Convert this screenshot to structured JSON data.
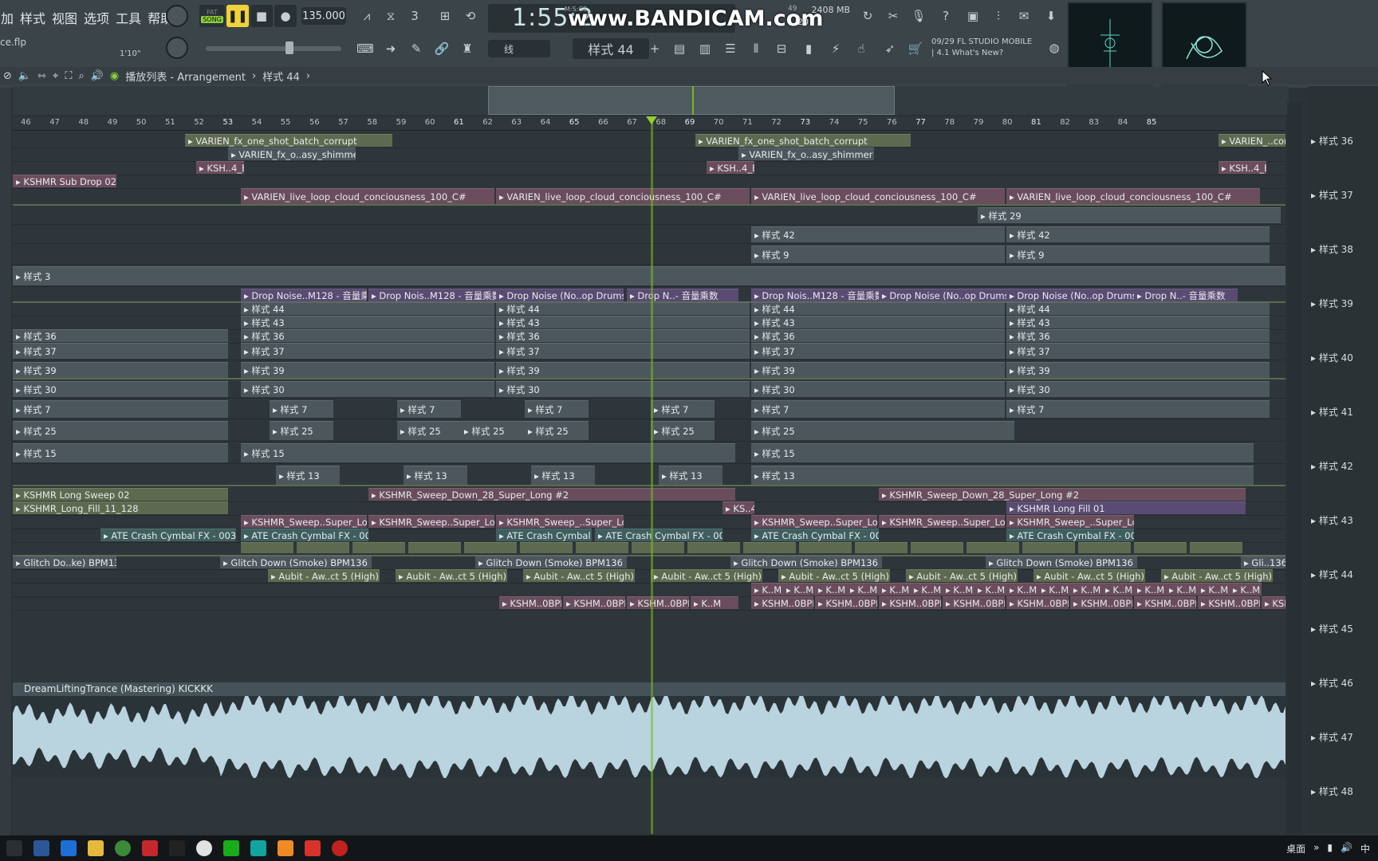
{
  "menu": [
    "加",
    "样式",
    "视图",
    "选项",
    "工具",
    "帮助"
  ],
  "file_name": "ce.flp",
  "time_sig": "1'10\"",
  "transport": {
    "mode_top": "PAT",
    "mode": "SONG",
    "tempo": "135.000",
    "clock": "1:55:2",
    "clock_unit": "M:S:CS"
  },
  "watermark": "www.BANDICAM.com",
  "cpu": {
    "mem": "2408 MB",
    "voices": "20",
    "cpu_left": "49"
  },
  "tool": {
    "snap": "线",
    "pattern": "样式 44"
  },
  "news": {
    "line1": "09/29  FL STUDIO MOBILE",
    "line2": "| 4.1 What's New?"
  },
  "breadcrumb": {
    "title": "播放列表 - Arrangement",
    "pattern": "样式 44"
  },
  "ruler_labels": [
    "46",
    "47",
    "48",
    "49",
    "50",
    "51",
    "52",
    "53",
    "54",
    "55",
    "56",
    "57",
    "58",
    "59",
    "60",
    "61",
    "62",
    "63",
    "64",
    "65",
    "66",
    "67",
    "68",
    "69",
    "70",
    "71",
    "72",
    "73",
    "74",
    "75",
    "76",
    "77",
    "78",
    "79",
    "80",
    "81",
    "82",
    "83",
    "84",
    "85"
  ],
  "clips": [
    {
      "text": "VARIEN_fx_one_shot_batch_corrupt",
      "row": 0,
      "c": "olive"
    },
    {
      "text": "VARIEN_fx_one_shot_batch_corrupt",
      "row": 0,
      "c": "olive"
    },
    {
      "text": "VARIEN_..corrupt",
      "row": 0,
      "c": "olive"
    },
    {
      "text": "VARIEN_fx_o..asy_shimmer",
      "row": 1,
      "c": "grey"
    },
    {
      "text": "VARIEN_fx_o..asy_shimmer",
      "row": 1,
      "c": "grey"
    },
    {
      "text": "KSH..4_E",
      "row": 2,
      "c": "pink"
    },
    {
      "text": "KSH..4_E",
      "row": 2,
      "c": "pink"
    },
    {
      "text": "KSH..4_E",
      "row": 2,
      "c": "pink"
    },
    {
      "text": "KSHMR Sub Drop 02",
      "row": 3,
      "c": "pink"
    },
    {
      "text": "VARIEN_live_loop_cloud_conciousness_100_C#",
      "row": 4,
      "c": "pink"
    },
    {
      "text": "VARIEN_live_loop_cloud_conciousness_100_C#",
      "row": 4,
      "c": "pink"
    },
    {
      "text": "VARIEN_live_loop_cloud_conciousness_100_C#",
      "row": 4,
      "c": "pink"
    },
    {
      "text": "VARIEN_live_loop_cloud_conciousness_100_C#",
      "row": 4,
      "c": "pink"
    },
    {
      "text": "样式 29",
      "row": 5,
      "c": "grey"
    },
    {
      "text": "样式 42",
      "row": 6,
      "c": "grey"
    },
    {
      "text": "样式 42",
      "row": 6,
      "c": "grey"
    },
    {
      "text": "样式 9",
      "row": 7,
      "c": "grey"
    },
    {
      "text": "样式 9",
      "row": 7,
      "c": "grey"
    },
    {
      "text": "样式 3",
      "row": 8,
      "c": "grey"
    },
    {
      "text": "Drop Noise..M128 - 音量乘数",
      "row": 9,
      "c": "purple"
    },
    {
      "text": "Drop Nois..M128 - 音量乘数",
      "row": 9,
      "c": "purple"
    },
    {
      "text": "Drop Noise (No..op Drums 3",
      "row": 9,
      "c": "purple"
    },
    {
      "text": "Drop N..- 音量乘数",
      "row": 9,
      "c": "purple"
    },
    {
      "text": "Drop Nois..M128 - 音量乘数",
      "row": 9,
      "c": "purple"
    },
    {
      "text": "Drop Noise (No..op Drums 3",
      "row": 9,
      "c": "purple"
    },
    {
      "text": "Drop Noise (No..op Drums 3",
      "row": 9,
      "c": "purple"
    },
    {
      "text": "Drop N..- 音量乘数",
      "row": 9,
      "c": "purple"
    },
    {
      "text": "样式 44",
      "row": 10,
      "c": "grey"
    },
    {
      "text": "样式 44",
      "row": 10,
      "c": "grey"
    },
    {
      "text": "样式 44",
      "row": 10,
      "c": "grey"
    },
    {
      "text": "样式 44",
      "row": 10,
      "c": "grey"
    },
    {
      "text": "样式 43",
      "row": 11,
      "c": "grey"
    },
    {
      "text": "样式 43",
      "row": 11,
      "c": "grey"
    },
    {
      "text": "样式 43",
      "row": 11,
      "c": "grey"
    },
    {
      "text": "样式 43",
      "row": 11,
      "c": "grey"
    },
    {
      "text": "样式 36",
      "row": 12,
      "c": "grey"
    },
    {
      "text": "样式 36",
      "row": 12,
      "c": "grey"
    },
    {
      "text": "样式 36",
      "row": 12,
      "c": "grey"
    },
    {
      "text": "样式 36",
      "row": 12,
      "c": "grey"
    },
    {
      "text": "样式 36",
      "row": 12,
      "c": "grey"
    },
    {
      "text": "样式 37",
      "row": 13,
      "c": "grey"
    },
    {
      "text": "样式 37",
      "row": 13,
      "c": "grey"
    },
    {
      "text": "样式 37",
      "row": 13,
      "c": "grey"
    },
    {
      "text": "样式 37",
      "row": 13,
      "c": "grey"
    },
    {
      "text": "样式 37",
      "row": 13,
      "c": "grey"
    },
    {
      "text": "样式 39",
      "row": 14,
      "c": "grey"
    },
    {
      "text": "样式 39",
      "row": 14,
      "c": "grey"
    },
    {
      "text": "样式 39",
      "row": 14,
      "c": "grey"
    },
    {
      "text": "样式 39",
      "row": 14,
      "c": "grey"
    },
    {
      "text": "样式 39",
      "row": 14,
      "c": "grey"
    },
    {
      "text": "样式 30",
      "row": 15,
      "c": "grey"
    },
    {
      "text": "样式 30",
      "row": 15,
      "c": "grey"
    },
    {
      "text": "样式 30",
      "row": 15,
      "c": "grey"
    },
    {
      "text": "样式 30",
      "row": 15,
      "c": "grey"
    },
    {
      "text": "样式 30",
      "row": 15,
      "c": "grey"
    },
    {
      "text": "样式 7",
      "row": 16,
      "c": "grey"
    },
    {
      "text": "样式 7",
      "row": 16,
      "c": "grey"
    },
    {
      "text": "样式 7",
      "row": 16,
      "c": "grey"
    },
    {
      "text": "样式 7",
      "row": 16,
      "c": "grey"
    },
    {
      "text": "样式 7",
      "row": 16,
      "c": "grey"
    },
    {
      "text": "样式 7",
      "row": 16,
      "c": "grey"
    },
    {
      "text": "样式 7",
      "row": 16,
      "c": "grey"
    },
    {
      "text": "样式 25",
      "row": 17,
      "c": "grey"
    },
    {
      "text": "样式 25",
      "row": 17,
      "c": "grey"
    },
    {
      "text": "样式 25",
      "row": 17,
      "c": "grey"
    },
    {
      "text": "样式 25",
      "row": 17,
      "c": "grey"
    },
    {
      "text": "样式 25",
      "row": 17,
      "c": "grey"
    },
    {
      "text": "样式 25",
      "row": 17,
      "c": "grey"
    },
    {
      "text": "样式 25",
      "row": 17,
      "c": "grey"
    },
    {
      "text": "样式 15",
      "row": 18,
      "c": "grey"
    },
    {
      "text": "样式 15",
      "row": 18,
      "c": "grey"
    },
    {
      "text": "样式 15",
      "row": 18,
      "c": "grey"
    },
    {
      "text": "样式 13",
      "row": 19,
      "c": "grey"
    },
    {
      "text": "样式 13",
      "row": 19,
      "c": "grey"
    },
    {
      "text": "样式 13",
      "row": 19,
      "c": "grey"
    },
    {
      "text": "样式 13",
      "row": 19,
      "c": "grey"
    },
    {
      "text": "样式 13",
      "row": 19,
      "c": "grey"
    },
    {
      "text": "KSHMR Long Sweep 02",
      "row": 20,
      "c": "olive"
    },
    {
      "text": "KSHMR_Sweep_Down_28_Super_Long #2",
      "row": 20,
      "c": "pink"
    },
    {
      "text": "KSHMR_Sweep_Down_28_Super_Long #2",
      "row": 20,
      "c": "pink"
    },
    {
      "text": "KSHMR_Long_Fill_11_128",
      "row": 21,
      "c": "olive"
    },
    {
      "text": "KS..4",
      "row": 21,
      "c": "pink"
    },
    {
      "text": "KSHMR Long Fill 01",
      "row": 21,
      "c": "purple"
    },
    {
      "text": "KSHMR_Sweep..Super_Long",
      "row": 22,
      "c": "pink"
    },
    {
      "text": "KSHMR_Sweep..Super_Long",
      "row": 22,
      "c": "pink"
    },
    {
      "text": "KSHMR_Sweep_..Super_Long",
      "row": 22,
      "c": "pink"
    },
    {
      "text": "KSHMR_Sweep..Super_Long",
      "row": 22,
      "c": "pink"
    },
    {
      "text": "KSHMR_Sweep..Super_Long",
      "row": 22,
      "c": "pink"
    },
    {
      "text": "KSHMR_Sweep_..Super_Long",
      "row": 22,
      "c": "pink"
    },
    {
      "text": "ATE Crash Cymbal FX - 003 #2",
      "row": 23,
      "c": "teal"
    },
    {
      "text": "ATE Crash Cymbal FX - 003",
      "row": 23,
      "c": "teal"
    },
    {
      "text": "ATE Crash Cymbal F.",
      "row": 23,
      "c": "teal"
    },
    {
      "text": "ATE Crash Cymbal FX - 003 #2",
      "row": 23,
      "c": "teal"
    },
    {
      "text": "ATE Crash Cymbal FX - 003",
      "row": 23,
      "c": "teal"
    },
    {
      "text": "ATE Crash Cymbal FX - 003",
      "row": 23,
      "c": "teal"
    },
    {
      "text": "Glitch Do..ke) BPM136",
      "row": 25,
      "c": "grey"
    },
    {
      "text": "Glitch Down (Smoke) BPM136",
      "row": 25,
      "c": "grey"
    },
    {
      "text": "Glitch Down (Smoke) BPM136",
      "row": 25,
      "c": "grey"
    },
    {
      "text": "Glitch Down (Smoke) BPM136",
      "row": 25,
      "c": "grey"
    },
    {
      "text": "Glitch Down (Smoke) BPM136",
      "row": 25,
      "c": "grey"
    },
    {
      "text": "Gli..136",
      "row": 25,
      "c": "grey"
    },
    {
      "text": "Aubit - Aw..ct 5 (High)",
      "row": 26,
      "c": "olive"
    },
    {
      "text": "Aubit - Aw..ct 5 (High)",
      "row": 26,
      "c": "olive"
    },
    {
      "text": "Aubit - Aw..ct 5 (High)",
      "row": 26,
      "c": "olive"
    },
    {
      "text": "Aubit - Aw..ct 5 (High)",
      "row": 26,
      "c": "olive"
    },
    {
      "text": "Aubit - Aw..ct 5 (High)",
      "row": 26,
      "c": "olive"
    },
    {
      "text": "Aubit - Aw..ct 5 (High)",
      "row": 26,
      "c": "olive"
    },
    {
      "text": "Aubit - Aw..ct 5 (High)",
      "row": 26,
      "c": "olive"
    },
    {
      "text": "Aubit - Aw..ct 5 (High)",
      "row": 26,
      "c": "olive"
    },
    {
      "text": "Aubit - Aw..ct 5 (High)",
      "row": 26,
      "c": "olive"
    },
    {
      "text": "K..M",
      "row": 27,
      "c": "pink"
    },
    {
      "text": "K..M",
      "row": 27,
      "c": "pink"
    },
    {
      "text": "K..M",
      "row": 27,
      "c": "pink"
    },
    {
      "text": "K..M",
      "row": 27,
      "c": "pink"
    },
    {
      "text": "K..M",
      "row": 27,
      "c": "pink"
    },
    {
      "text": "K..M",
      "row": 27,
      "c": "pink"
    },
    {
      "text": "K..M",
      "row": 27,
      "c": "pink"
    },
    {
      "text": "K..M",
      "row": 27,
      "c": "pink"
    },
    {
      "text": "K..M",
      "row": 27,
      "c": "pink"
    },
    {
      "text": "K..M",
      "row": 27,
      "c": "pink"
    },
    {
      "text": "K..M",
      "row": 27,
      "c": "pink"
    },
    {
      "text": "K..M",
      "row": 27,
      "c": "pink"
    },
    {
      "text": "K..M",
      "row": 27,
      "c": "pink"
    },
    {
      "text": "K..M",
      "row": 27,
      "c": "pink"
    },
    {
      "text": "K..M",
      "row": 27,
      "c": "pink"
    },
    {
      "text": "K..M",
      "row": 27,
      "c": "pink"
    },
    {
      "text": "KSHM..0BPM",
      "row": 28,
      "c": "pink"
    },
    {
      "text": "KSHM..0BPM",
      "row": 28,
      "c": "pink"
    },
    {
      "text": "KSHM..0BPM",
      "row": 28,
      "c": "pink"
    },
    {
      "text": "K..M",
      "row": 28,
      "c": "pink"
    },
    {
      "text": "KSHM..0BPM",
      "row": 28,
      "c": "pink"
    },
    {
      "text": "KSHM..0BPM",
      "row": 28,
      "c": "pink"
    },
    {
      "text": "KSHM..0BPM",
      "row": 28,
      "c": "pink"
    },
    {
      "text": "KSHM..0BPM",
      "row": 28,
      "c": "pink"
    },
    {
      "text": "KSHM..0BPM",
      "row": 28,
      "c": "pink"
    },
    {
      "text": "KSHM..0BPM",
      "row": 28,
      "c": "pink"
    },
    {
      "text": "KSHM..0BPM",
      "row": 28,
      "c": "pink"
    },
    {
      "text": "KSHM..0BPM",
      "row": 28,
      "c": "pink"
    },
    {
      "text": "KSHM..0BPM",
      "row": 28,
      "c": "pink"
    }
  ],
  "audio_track": {
    "name": "DreamLiftingTrance (Mastering) KICKKK"
  },
  "picker": [
    "样式 36",
    "样式 37",
    "样式 38",
    "样式 39",
    "样式 40",
    "样式 41",
    "样式 42",
    "样式 43",
    "样式 44",
    "样式 45",
    "样式 46",
    "样式 47",
    "样式 48"
  ],
  "taskbar": {
    "desktop": "桌面",
    "ime": "中"
  },
  "colors": {
    "accent": "#7fb21f",
    "clip_text": "#e6eaec"
  }
}
